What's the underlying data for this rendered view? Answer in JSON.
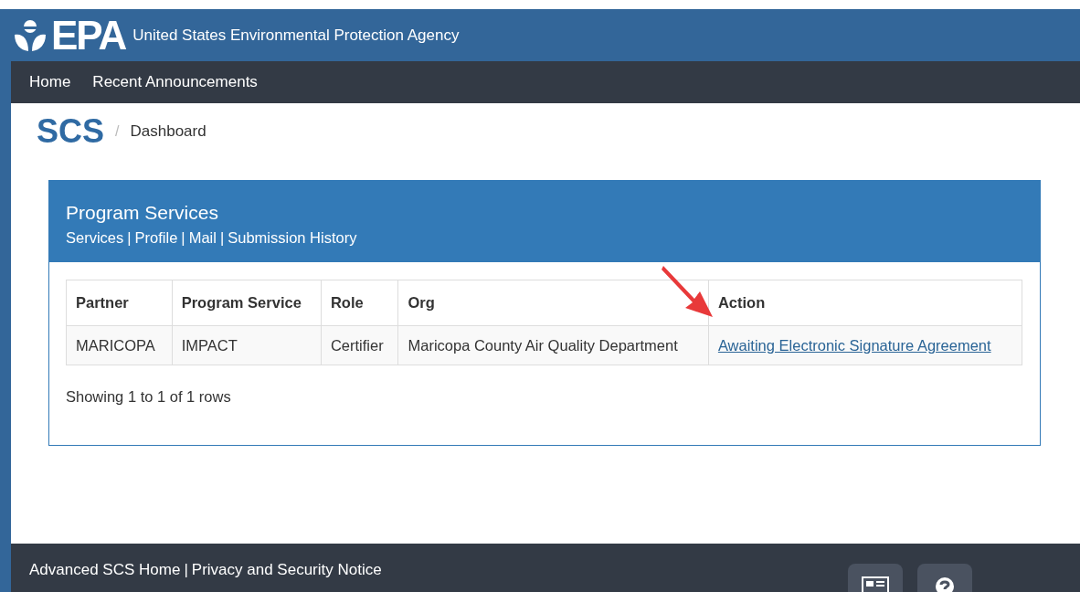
{
  "header": {
    "logo": "EPA",
    "title": "United States Environmental Protection Agency"
  },
  "nav": [
    {
      "label": "Home"
    },
    {
      "label": "Recent Announcements"
    }
  ],
  "breadcrumb": {
    "logo": "SCS",
    "separator": "/",
    "current": "Dashboard"
  },
  "panel": {
    "title": "Program Services",
    "links": [
      {
        "label": "Services"
      },
      {
        "label": "Profile"
      },
      {
        "label": "Mail"
      },
      {
        "label": "Submission History"
      }
    ],
    "link_separator": "|",
    "table": {
      "columns": [
        "Partner",
        "Program Service",
        "Role",
        "Org",
        "Action"
      ],
      "rows": [
        {
          "cells": [
            "MARICOPA",
            "IMPACT",
            "Certifier",
            "Maricopa County Air Quality Department"
          ],
          "action": "Awaiting Electronic Signature Agreement"
        }
      ]
    },
    "footer_text": "Showing 1 to 1 of 1 rows"
  },
  "footer": {
    "links": [
      {
        "label": "Advanced SCS Home"
      },
      {
        "label": "Privacy and Security Notice"
      }
    ],
    "separator": "|"
  }
}
